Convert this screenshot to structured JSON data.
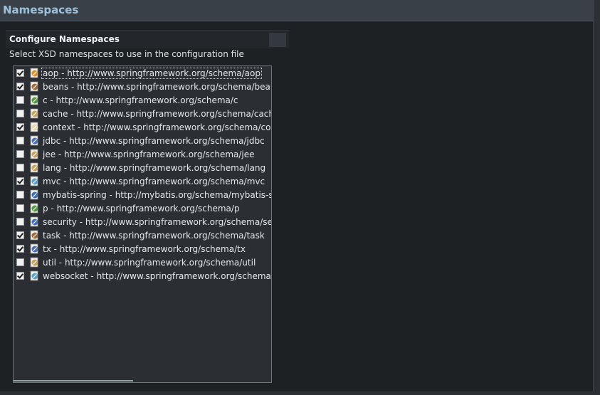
{
  "header": {
    "title": "Namespaces"
  },
  "section": {
    "title": "Configure Namespaces",
    "description": "Select XSD namespaces to use in the configuration file"
  },
  "namespaces": [
    {
      "label": "aop - http://www.springframework.org/schema/aop",
      "checked": true,
      "icon": "aop-icon",
      "color": "#d9912e"
    },
    {
      "label": "beans - http://www.springframework.org/schema/beans",
      "checked": true,
      "icon": "beans-icon",
      "color": "#9b6b3d"
    },
    {
      "label": "c - http://www.springframework.org/schema/c",
      "checked": false,
      "icon": "c-icon",
      "color": "#4f9a3e"
    },
    {
      "label": "cache - http://www.springframework.org/schema/cache",
      "checked": false,
      "icon": "cache-icon",
      "color": "#c8a060"
    },
    {
      "label": "context - http://www.springframework.org/schema/context",
      "checked": true,
      "icon": "context-icon",
      "color": "#e7d7b5"
    },
    {
      "label": "jdbc - http://www.springframework.org/schema/jdbc",
      "checked": false,
      "icon": "jdbc-icon",
      "color": "#4a6fb5"
    },
    {
      "label": "jee - http://www.springframework.org/schema/jee",
      "checked": false,
      "icon": "jee-icon",
      "color": "#c8a060"
    },
    {
      "label": "lang - http://www.springframework.org/schema/lang",
      "checked": false,
      "icon": "lang-icon",
      "color": "#c8a060"
    },
    {
      "label": "mvc - http://www.springframework.org/schema/mvc",
      "checked": true,
      "icon": "mvc-icon",
      "color": "#5aa0c8"
    },
    {
      "label": "mybatis-spring - http://mybatis.org/schema/mybatis-spring",
      "checked": false,
      "icon": "mybatis-spring-icon",
      "color": "#3b6fb8"
    },
    {
      "label": "p - http://www.springframework.org/schema/p",
      "checked": false,
      "icon": "p-icon",
      "color": "#4f9a3e"
    },
    {
      "label": "security - http://www.springframework.org/schema/security",
      "checked": false,
      "icon": "security-icon",
      "color": "#3b6fb8"
    },
    {
      "label": "task - http://www.springframework.org/schema/task",
      "checked": true,
      "icon": "task-icon",
      "color": "#9b6b3d"
    },
    {
      "label": "tx - http://www.springframework.org/schema/tx",
      "checked": true,
      "icon": "tx-icon",
      "color": "#4a6fb5"
    },
    {
      "label": "util - http://www.springframework.org/schema/util",
      "checked": false,
      "icon": "util-icon",
      "color": "#c8a060"
    },
    {
      "label": "websocket - http://www.springframework.org/schema/webs",
      "checked": true,
      "icon": "websocket-icon",
      "color": "#5aa0c8"
    }
  ]
}
